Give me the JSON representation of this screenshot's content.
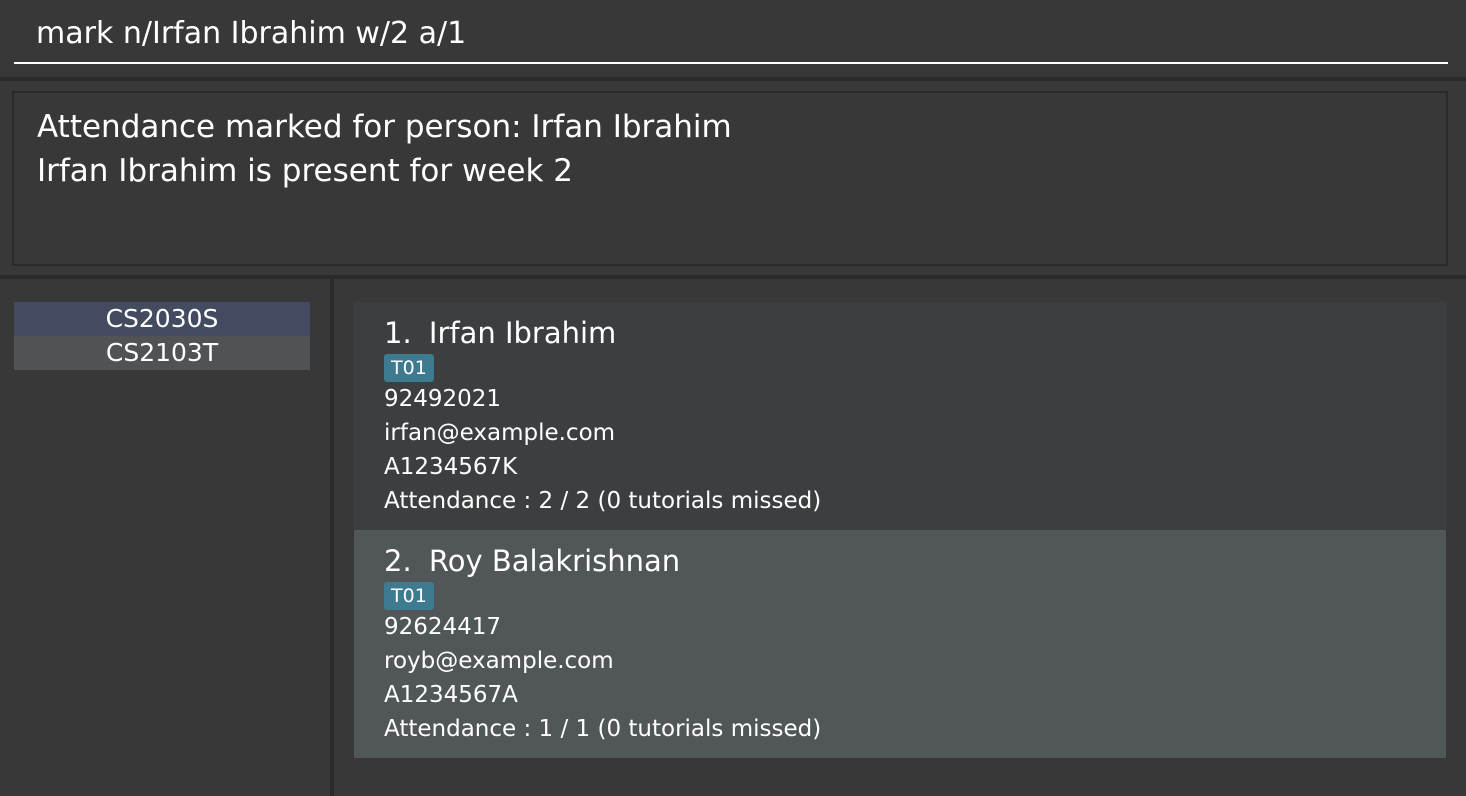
{
  "command": {
    "value": "mark n/Irfan Ibrahim w/2 a/1"
  },
  "result": {
    "lines": [
      "Attendance marked for person: Irfan Ibrahim",
      "Irfan Ibrahim is present for week 2"
    ]
  },
  "classes": [
    {
      "label": "CS2030S",
      "selected": true
    },
    {
      "label": "CS2103T",
      "selected": false
    }
  ],
  "persons": [
    {
      "index": "1.",
      "name": "Irfan Ibrahim",
      "tag": "T01",
      "phone": "92492021",
      "email": "irfan@example.com",
      "student_id": "A1234567K",
      "attendance": "Attendance : 2 / 2 (0 tutorials missed)"
    },
    {
      "index": "2.",
      "name": "Roy Balakrishnan",
      "tag": "T01",
      "phone": "92624417",
      "email": "royb@example.com",
      "student_id": "A1234567A",
      "attendance": "Attendance : 1 / 1 (0 tutorials missed)"
    }
  ],
  "colors": {
    "background": "#383838",
    "selected_class": "#424b5f",
    "tag": "#3e7b91",
    "card_odd": "#3c3e3f",
    "card_even": "#515658"
  }
}
